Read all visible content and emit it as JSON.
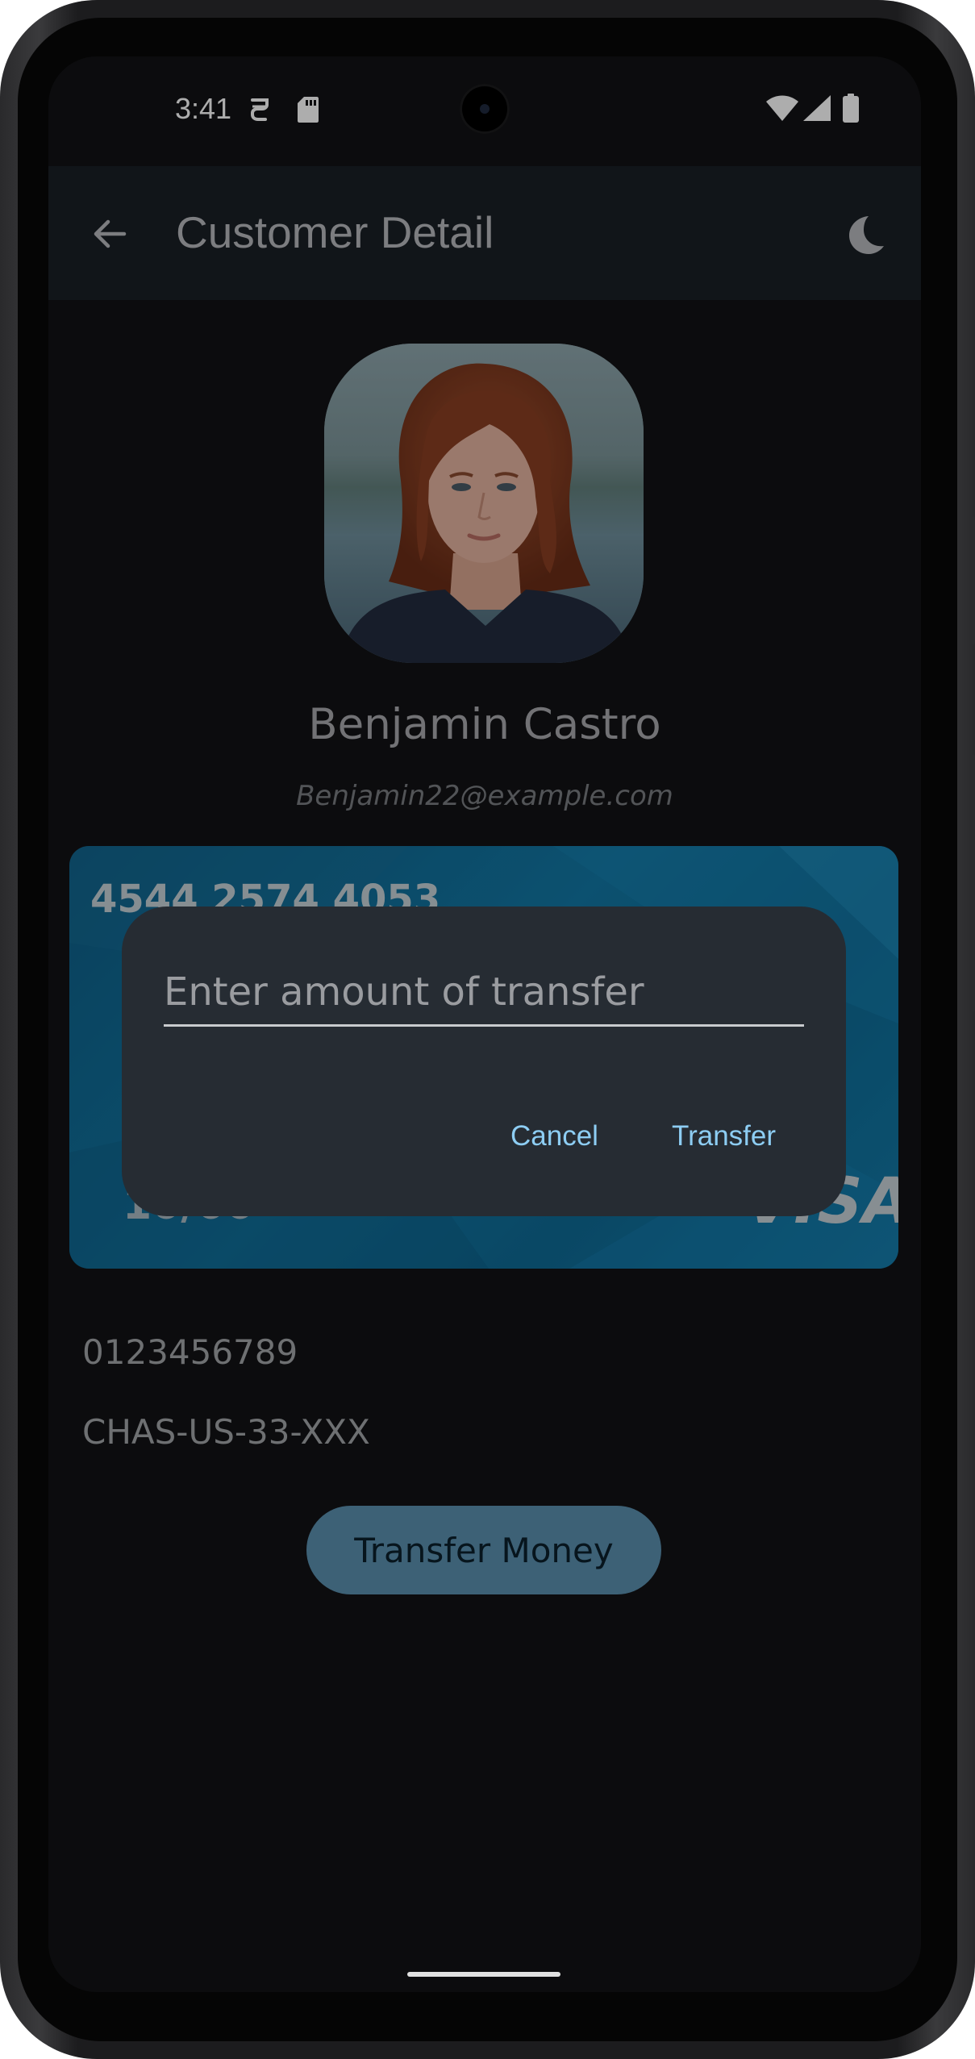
{
  "status_bar": {
    "time": "3:41",
    "left_icons": [
      "assistant-icon",
      "sd-card-icon"
    ],
    "right_icons": [
      "wifi-icon",
      "signal-icon",
      "battery-icon"
    ]
  },
  "app_bar": {
    "title": "Customer Detail",
    "back_icon": "arrow-back-icon",
    "theme_icon": "dark-mode-moon-icon"
  },
  "customer": {
    "name": "Benjamin Castro",
    "email": "Benjamin22@example.com",
    "account_number": "0123456789",
    "swift_code": "CHAS-US-33-XXX"
  },
  "card": {
    "number_partial": "4544 2574 4053",
    "expiry_partial": "10/00",
    "brand": "VISA"
  },
  "dialog": {
    "input_placeholder": "Enter amount of transfer",
    "input_value": "",
    "cancel_label": "Cancel",
    "confirm_label": "Transfer"
  },
  "actions": {
    "transfer_money_label": "Transfer Money"
  },
  "colors": {
    "background": "#121315",
    "app_bar": "#1a1f26",
    "card": "#1278a5",
    "dialog": "#262c33",
    "dialog_action": "#8dcdf3",
    "primary_button": "#5a8faf"
  }
}
